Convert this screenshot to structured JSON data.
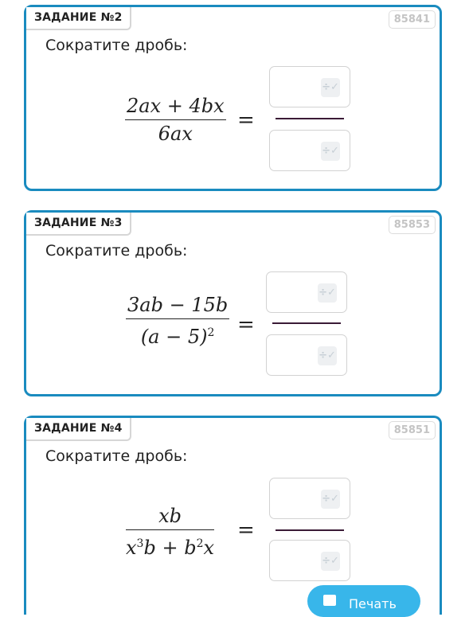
{
  "tasks": [
    {
      "label": "ЗАДАНИЕ №2",
      "id": "85841",
      "prompt": "Сократите дробь:",
      "numerator": "2ax + 4bx",
      "denominator": "6ax"
    },
    {
      "label": "ЗАДАНИЕ №3",
      "id": "85853",
      "prompt": "Сократите дробь:",
      "numerator": "3ab − 15b",
      "denominator": "(a − 5)",
      "denominator_exp": "2"
    },
    {
      "label": "ЗАДАНИЕ №4",
      "id": "85851",
      "prompt": "Сократите дробь:",
      "numerator": "xb",
      "denominator_parts": [
        "x",
        "3",
        "b + b",
        "2",
        "x"
      ]
    }
  ],
  "equals": "=",
  "answer_icon": "÷✓",
  "print_label": "Печать",
  "colors": {
    "border": "#1a8bbf",
    "answer_line": "#3a1a36",
    "print_button": "#38b6ea"
  }
}
